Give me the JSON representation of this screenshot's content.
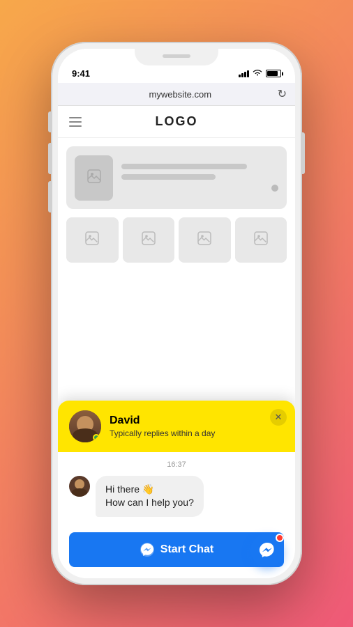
{
  "phone": {
    "status_bar": {
      "time": "9:41",
      "time_arrow": "▶"
    },
    "browser": {
      "url": "mywebsite.com",
      "refresh_icon": "↻"
    }
  },
  "website": {
    "logo": "LOGO",
    "nav_icon": "menu"
  },
  "chat_popup": {
    "close_icon": "✕",
    "agent": {
      "name": "David",
      "status": "Typically replies within a day"
    },
    "timestamp": "16:37",
    "message_line1": "Hi there 👋",
    "message_line2": "How can I help you?",
    "start_chat_button": "Start Chat"
  },
  "fab": {
    "label": "Messenger"
  }
}
